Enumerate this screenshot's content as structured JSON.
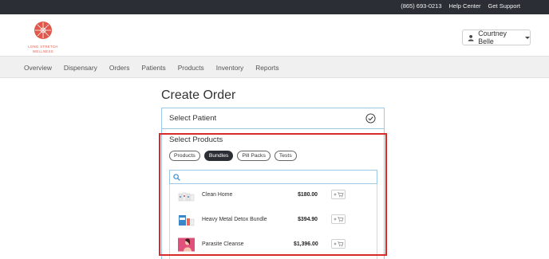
{
  "topbar": {
    "phone": "(865) 693-0213",
    "help_center": "Help Center",
    "get_support": "Get Support"
  },
  "logo": {
    "line1": "LONG STRETCH",
    "line2": "WELLNESS",
    "color": "#e0584b"
  },
  "user_menu": {
    "name": "Courtney Belle",
    "icon": "person-icon"
  },
  "nav": {
    "items": [
      "Overview",
      "Dispensary",
      "Orders",
      "Patients",
      "Products",
      "Inventory",
      "Reports"
    ]
  },
  "page": {
    "title": "Create Order"
  },
  "select_patient": {
    "label": "Select Patient",
    "status_icon": "check-circle-icon"
  },
  "select_products": {
    "label": "Select Products",
    "filters": [
      {
        "label": "Products",
        "active": false
      },
      {
        "label": "Bundles",
        "active": true
      },
      {
        "label": "Pill Packs",
        "active": false
      },
      {
        "label": "Tests",
        "active": false
      }
    ],
    "search": {
      "value": "",
      "placeholder": ""
    },
    "items": [
      {
        "name": "Clean Home",
        "price": "$180.00",
        "thumb_icon": "product-bottles-icon"
      },
      {
        "name": "Heavy Metal Detox Bundle",
        "price": "$394.90",
        "thumb_icon": "product-box-icon"
      },
      {
        "name": "Parasite Cleanse",
        "price": "$1,396.00",
        "thumb_icon": "product-pink-icon"
      }
    ]
  },
  "colors": {
    "topbar_bg": "#2b2f35",
    "panel_border": "#9cc8e6",
    "highlight_border": "#d62b2b",
    "active_pill": "#2b2f35"
  }
}
